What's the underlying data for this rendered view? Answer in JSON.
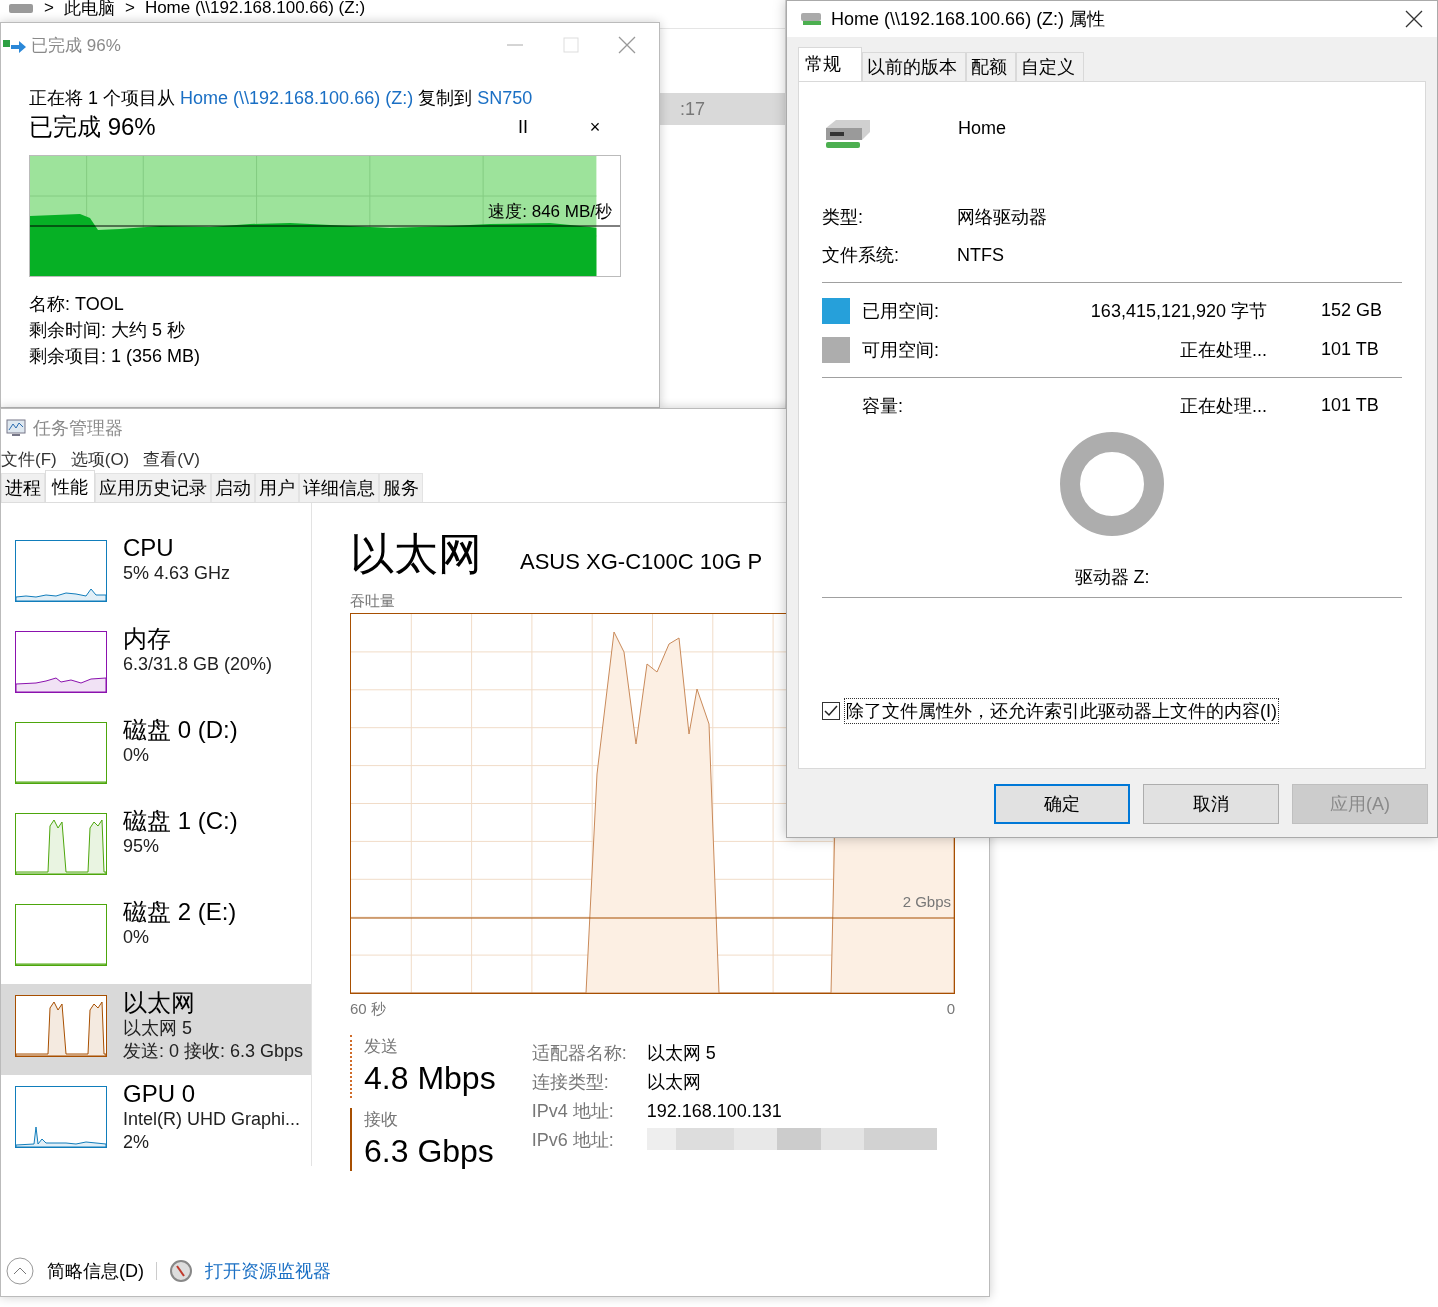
{
  "explorer": {
    "breadcrumb": [
      ">",
      "此电脑",
      ">",
      "Home (\\\\192.168.100.66) (Z:)"
    ],
    "row_fragment": {
      "text": ":17",
      "selected": true
    }
  },
  "copy_dialog": {
    "title": "已完成 96%",
    "message": [
      {
        "kind": "text",
        "text": "正在将 1 个项目从 "
      },
      {
        "kind": "link",
        "text": "Home (\\\\192.168.100.66) (Z:)"
      },
      {
        "kind": "text",
        "text": " 复制到 "
      },
      {
        "kind": "link",
        "text": "SN750"
      }
    ],
    "heading": "已完成 96%",
    "pause": "II",
    "cancel": "×",
    "level": 0.96,
    "speed": "速度: 846 MB/秒",
    "details": [
      {
        "label": "名称:",
        "value": "TOOL"
      },
      {
        "label": "剩余时间:",
        "value": "大约 5 秒"
      },
      {
        "label": "剩余项目:",
        "value": "1 (356 MB)"
      }
    ]
  },
  "task_manager": {
    "title": "任务管理器",
    "menu": [
      "文件(F)",
      "选项(O)",
      "查看(V)"
    ],
    "tabs": [
      {
        "label": "进程",
        "selected": false
      },
      {
        "label": "性能",
        "selected": true
      },
      {
        "label": "应用历史记录",
        "selected": false
      },
      {
        "label": "启动",
        "selected": false
      },
      {
        "label": "用户",
        "selected": false
      },
      {
        "label": "详细信息",
        "selected": false
      },
      {
        "label": "服务",
        "selected": false
      }
    ],
    "sidebar": [
      {
        "kind": "noise",
        "title": "CPU",
        "lines": [
          "5%  4.63 GHz"
        ],
        "color": "#117dbb",
        "selected": false
      },
      {
        "kind": "wave",
        "title": "内存",
        "lines": [
          "6.3/31.8 GB (20%)"
        ],
        "color": "#8b12ae",
        "selected": false
      },
      {
        "kind": "flat",
        "title": "磁盘 0 (D:)",
        "lines": [
          "0%"
        ],
        "color": "#4da60c",
        "selected": false
      },
      {
        "kind": "burst",
        "title": "磁盘 1 (C:)",
        "lines": [
          "95%"
        ],
        "color": "#4da60c",
        "selected": false
      },
      {
        "kind": "flat",
        "title": "磁盘 2 (E:)",
        "lines": [
          "0%"
        ],
        "color": "#4da60c",
        "selected": false
      },
      {
        "kind": "burst",
        "title": "以太网",
        "lines": [
          "以太网 5",
          "发送: 0 接收: 6.3 Gbps"
        ],
        "color": "#a74f01",
        "selected": true
      },
      {
        "kind": "spike",
        "title": "GPU 0",
        "lines": [
          "Intel(R) UHD Graphi...",
          "2%"
        ],
        "color": "#117dbb",
        "selected": false
      }
    ],
    "heading": "以太网",
    "adapter": "ASUS XG-C100C 10G P",
    "chart_label": "吞吐量",
    "scale_label": "2 Gbps",
    "time_start": "60 秒",
    "time_end": "0",
    "stats": [
      {
        "kind": "dashed",
        "label": "发送",
        "value": "4.8 Mbps"
      },
      {
        "kind": "solid",
        "label": "接收",
        "value": "6.3 Gbps"
      }
    ],
    "details": [
      {
        "label": "适配器名称:",
        "value": "以太网 5"
      },
      {
        "label": "连接类型:",
        "value": "以太网"
      },
      {
        "label": "IPv4 地址:",
        "value": "192.168.100.131"
      },
      {
        "label": "IPv6 地址:"
      }
    ],
    "footer": {
      "summary": "简略信息(D)",
      "monitor_link": "打开资源监视器"
    }
  },
  "properties": {
    "title": "Home (\\\\192.168.100.66) (Z:) 属性",
    "tabs": [
      {
        "label": "常规",
        "selected": true
      },
      {
        "label": "以前的版本",
        "selected": false
      },
      {
        "label": "配额",
        "selected": false
      },
      {
        "label": "自定义",
        "selected": false
      }
    ],
    "name": "Home",
    "info": [
      {
        "label": "类型:",
        "value": "网络驱动器"
      },
      {
        "label": "文件系统:",
        "value": "NTFS"
      }
    ],
    "space": [
      {
        "label": "已用空间:",
        "bytes": "163,415,121,920 字节",
        "size": "152 GB",
        "color": "#26a0da"
      },
      {
        "label": "可用空间:",
        "bytes": "正在处理...",
        "size": "101 TB",
        "color": "#adadad"
      }
    ],
    "capacity": {
      "label": "容量:",
      "bytes": "正在处理...",
      "size": "101 TB"
    },
    "drive_label": "驱动器 Z:",
    "index_option": {
      "label": "除了文件属性外，还允许索引此驱动器上文件的内容(I)",
      "checked": true
    },
    "buttons": [
      {
        "label": "确定",
        "kind": "default",
        "disabled": false
      },
      {
        "label": "取消",
        "kind": "normal",
        "disabled": false
      },
      {
        "label": "应用(A)",
        "kind": "normal",
        "disabled": true
      }
    ]
  }
}
